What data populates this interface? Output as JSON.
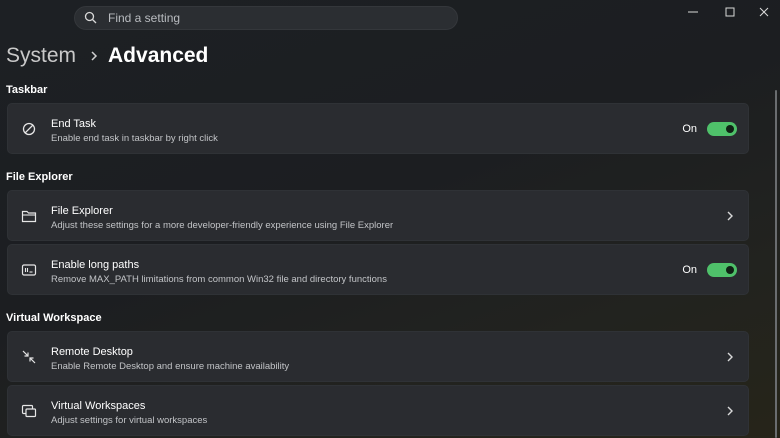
{
  "search": {
    "placeholder": "Find a setting"
  },
  "breadcrumb": {
    "parent": "System",
    "current": "Advanced"
  },
  "sections": [
    {
      "title": "Taskbar",
      "items": [
        {
          "title": "End Task",
          "subtitle": "Enable end task in taskbar by right click",
          "icon": "prohibited-icon",
          "control": "toggle",
          "state": "On"
        }
      ]
    },
    {
      "title": "File Explorer",
      "items": [
        {
          "title": "File Explorer",
          "subtitle": "Adjust these settings for a more developer-friendly experience using File Explorer",
          "icon": "folder-icon",
          "control": "chevron"
        },
        {
          "title": "Enable long paths",
          "subtitle": "Remove MAX_PATH limitations from common Win32 file and directory functions",
          "icon": "long-path-icon",
          "control": "toggle",
          "state": "On"
        }
      ]
    },
    {
      "title": "Virtual Workspace",
      "items": [
        {
          "title": "Remote Desktop",
          "subtitle": "Enable Remote Desktop and ensure machine availability",
          "icon": "remote-desktop-icon",
          "control": "chevron"
        },
        {
          "title": "Virtual Workspaces",
          "subtitle": "Adjust settings for virtual workspaces",
          "icon": "virtual-workspace-icon",
          "control": "chevron"
        }
      ]
    }
  ],
  "colors": {
    "accent": "#4fc16a",
    "card": "#2a2c30",
    "background": "#1d2024"
  }
}
